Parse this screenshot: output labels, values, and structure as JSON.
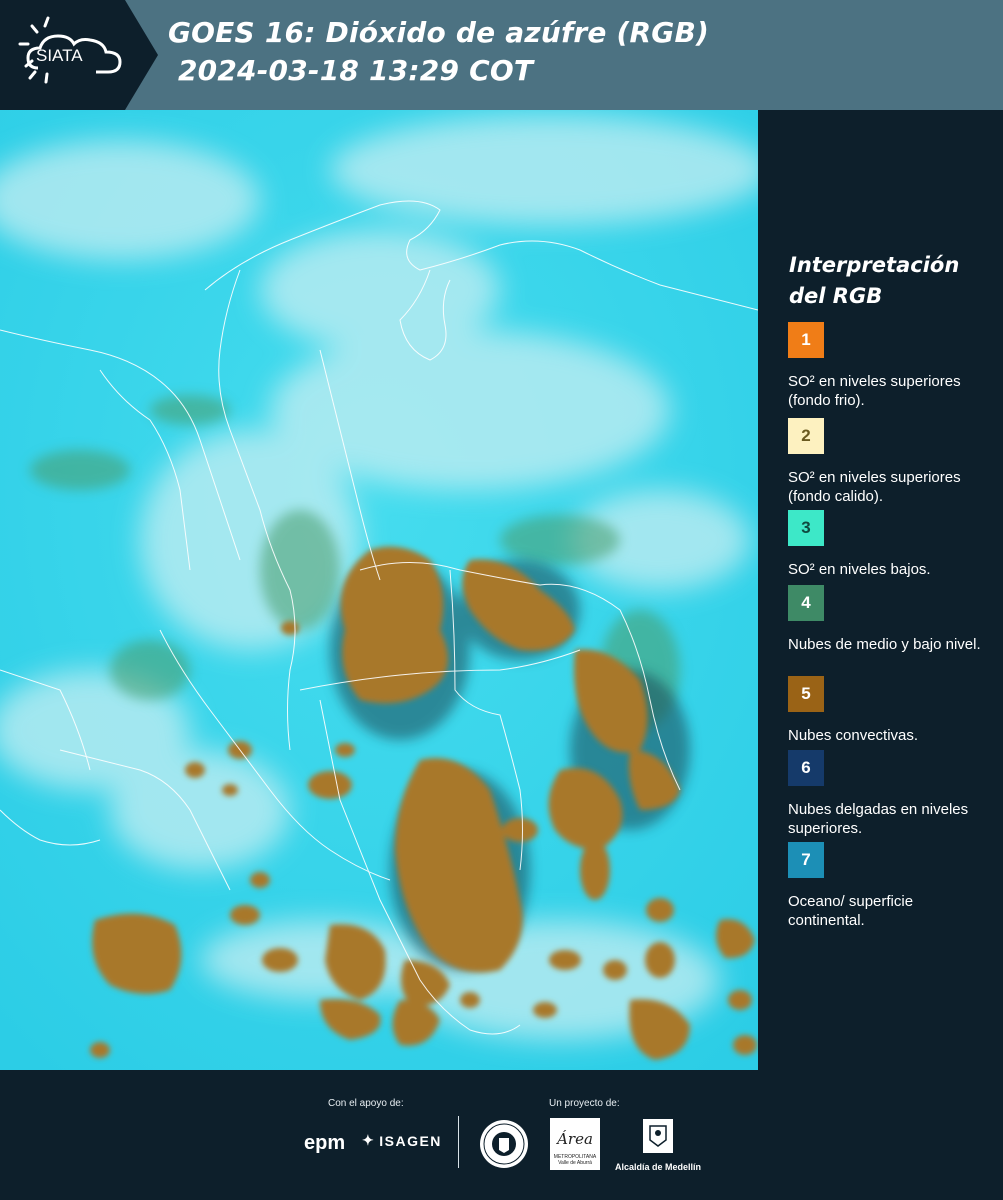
{
  "header": {
    "logo_text": "SIATA",
    "title_line1": "GOES 16: Dióxido de azúfre (RGB)",
    "title_line2": "2024-03-18 13:29 COT",
    "bg_color": "#4c7282",
    "logo_bg_color": "#0d1f2b"
  },
  "map": {
    "ocean_color": "#35d6ec",
    "cloud_color": "#c3e9ee",
    "convective_color": "#a8782c",
    "border_color": "#ffffff"
  },
  "legend": {
    "title_line1": "Interpretación",
    "title_line2": "del RGB",
    "items": [
      {
        "number": "1",
        "color": "#f07d17",
        "text_color": "#ffffff",
        "description": "SO² en niveles superiores (fondo frio)."
      },
      {
        "number": "2",
        "color": "#fdf1c0",
        "text_color": "#6a5a20",
        "description": "SO² en niveles superiores (fondo calido)."
      },
      {
        "number": "3",
        "color": "#3de8c8",
        "text_color": "#0f4a40",
        "description": "SO² en niveles bajos."
      },
      {
        "number": "4",
        "color": "#3e8a66",
        "text_color": "#ffffff",
        "description": "Nubes de medio y bajo nivel."
      },
      {
        "number": "5",
        "color": "#9a6316",
        "text_color": "#ffffff",
        "description": "Nubes convectivas."
      },
      {
        "number": "6",
        "color": "#153a6a",
        "text_color": "#ffffff",
        "description": "Nubes delgadas en niveles superiores."
      },
      {
        "number": "7",
        "color": "#1c8fb6",
        "text_color": "#ffffff",
        "description": "Oceano/ superficie continental."
      }
    ]
  },
  "footer": {
    "support_label": "Con el apoyo de:",
    "project_label": "Un proyecto de:",
    "epm_logo": "epm",
    "isagen_logo": "ISAGEN",
    "area_logo": "Área",
    "area_sub1": "METROPOLITANA",
    "area_sub2": "Valle de Aburrá",
    "alcaldia_label": "Alcaldía de Medellín"
  }
}
